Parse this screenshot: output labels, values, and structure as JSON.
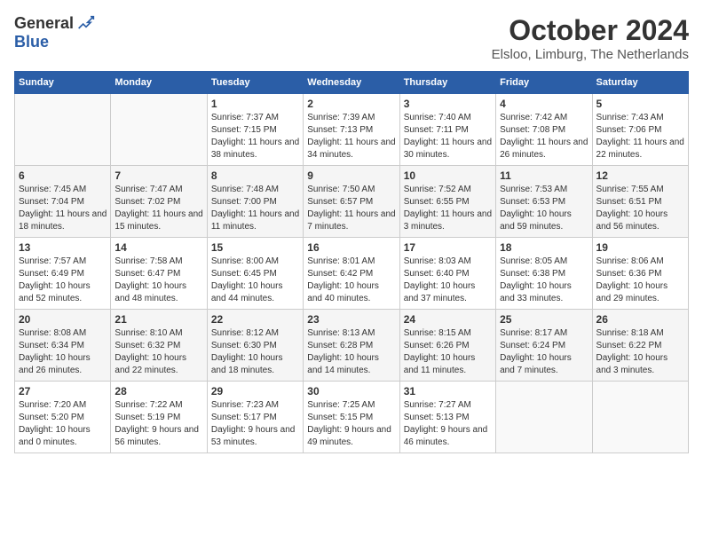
{
  "header": {
    "logo_general": "General",
    "logo_blue": "Blue",
    "month_title": "October 2024",
    "location": "Elsloo, Limburg, The Netherlands"
  },
  "weekdays": [
    "Sunday",
    "Monday",
    "Tuesday",
    "Wednesday",
    "Thursday",
    "Friday",
    "Saturday"
  ],
  "weeks": [
    [
      {
        "day": "",
        "info": ""
      },
      {
        "day": "",
        "info": ""
      },
      {
        "day": "1",
        "info": "Sunrise: 7:37 AM\nSunset: 7:15 PM\nDaylight: 11 hours and 38 minutes."
      },
      {
        "day": "2",
        "info": "Sunrise: 7:39 AM\nSunset: 7:13 PM\nDaylight: 11 hours and 34 minutes."
      },
      {
        "day": "3",
        "info": "Sunrise: 7:40 AM\nSunset: 7:11 PM\nDaylight: 11 hours and 30 minutes."
      },
      {
        "day": "4",
        "info": "Sunrise: 7:42 AM\nSunset: 7:08 PM\nDaylight: 11 hours and 26 minutes."
      },
      {
        "day": "5",
        "info": "Sunrise: 7:43 AM\nSunset: 7:06 PM\nDaylight: 11 hours and 22 minutes."
      }
    ],
    [
      {
        "day": "6",
        "info": "Sunrise: 7:45 AM\nSunset: 7:04 PM\nDaylight: 11 hours and 18 minutes."
      },
      {
        "day": "7",
        "info": "Sunrise: 7:47 AM\nSunset: 7:02 PM\nDaylight: 11 hours and 15 minutes."
      },
      {
        "day": "8",
        "info": "Sunrise: 7:48 AM\nSunset: 7:00 PM\nDaylight: 11 hours and 11 minutes."
      },
      {
        "day": "9",
        "info": "Sunrise: 7:50 AM\nSunset: 6:57 PM\nDaylight: 11 hours and 7 minutes."
      },
      {
        "day": "10",
        "info": "Sunrise: 7:52 AM\nSunset: 6:55 PM\nDaylight: 11 hours and 3 minutes."
      },
      {
        "day": "11",
        "info": "Sunrise: 7:53 AM\nSunset: 6:53 PM\nDaylight: 10 hours and 59 minutes."
      },
      {
        "day": "12",
        "info": "Sunrise: 7:55 AM\nSunset: 6:51 PM\nDaylight: 10 hours and 56 minutes."
      }
    ],
    [
      {
        "day": "13",
        "info": "Sunrise: 7:57 AM\nSunset: 6:49 PM\nDaylight: 10 hours and 52 minutes."
      },
      {
        "day": "14",
        "info": "Sunrise: 7:58 AM\nSunset: 6:47 PM\nDaylight: 10 hours and 48 minutes."
      },
      {
        "day": "15",
        "info": "Sunrise: 8:00 AM\nSunset: 6:45 PM\nDaylight: 10 hours and 44 minutes."
      },
      {
        "day": "16",
        "info": "Sunrise: 8:01 AM\nSunset: 6:42 PM\nDaylight: 10 hours and 40 minutes."
      },
      {
        "day": "17",
        "info": "Sunrise: 8:03 AM\nSunset: 6:40 PM\nDaylight: 10 hours and 37 minutes."
      },
      {
        "day": "18",
        "info": "Sunrise: 8:05 AM\nSunset: 6:38 PM\nDaylight: 10 hours and 33 minutes."
      },
      {
        "day": "19",
        "info": "Sunrise: 8:06 AM\nSunset: 6:36 PM\nDaylight: 10 hours and 29 minutes."
      }
    ],
    [
      {
        "day": "20",
        "info": "Sunrise: 8:08 AM\nSunset: 6:34 PM\nDaylight: 10 hours and 26 minutes."
      },
      {
        "day": "21",
        "info": "Sunrise: 8:10 AM\nSunset: 6:32 PM\nDaylight: 10 hours and 22 minutes."
      },
      {
        "day": "22",
        "info": "Sunrise: 8:12 AM\nSunset: 6:30 PM\nDaylight: 10 hours and 18 minutes."
      },
      {
        "day": "23",
        "info": "Sunrise: 8:13 AM\nSunset: 6:28 PM\nDaylight: 10 hours and 14 minutes."
      },
      {
        "day": "24",
        "info": "Sunrise: 8:15 AM\nSunset: 6:26 PM\nDaylight: 10 hours and 11 minutes."
      },
      {
        "day": "25",
        "info": "Sunrise: 8:17 AM\nSunset: 6:24 PM\nDaylight: 10 hours and 7 minutes."
      },
      {
        "day": "26",
        "info": "Sunrise: 8:18 AM\nSunset: 6:22 PM\nDaylight: 10 hours and 3 minutes."
      }
    ],
    [
      {
        "day": "27",
        "info": "Sunrise: 7:20 AM\nSunset: 5:20 PM\nDaylight: 10 hours and 0 minutes."
      },
      {
        "day": "28",
        "info": "Sunrise: 7:22 AM\nSunset: 5:19 PM\nDaylight: 9 hours and 56 minutes."
      },
      {
        "day": "29",
        "info": "Sunrise: 7:23 AM\nSunset: 5:17 PM\nDaylight: 9 hours and 53 minutes."
      },
      {
        "day": "30",
        "info": "Sunrise: 7:25 AM\nSunset: 5:15 PM\nDaylight: 9 hours and 49 minutes."
      },
      {
        "day": "31",
        "info": "Sunrise: 7:27 AM\nSunset: 5:13 PM\nDaylight: 9 hours and 46 minutes."
      },
      {
        "day": "",
        "info": ""
      },
      {
        "day": "",
        "info": ""
      }
    ]
  ]
}
